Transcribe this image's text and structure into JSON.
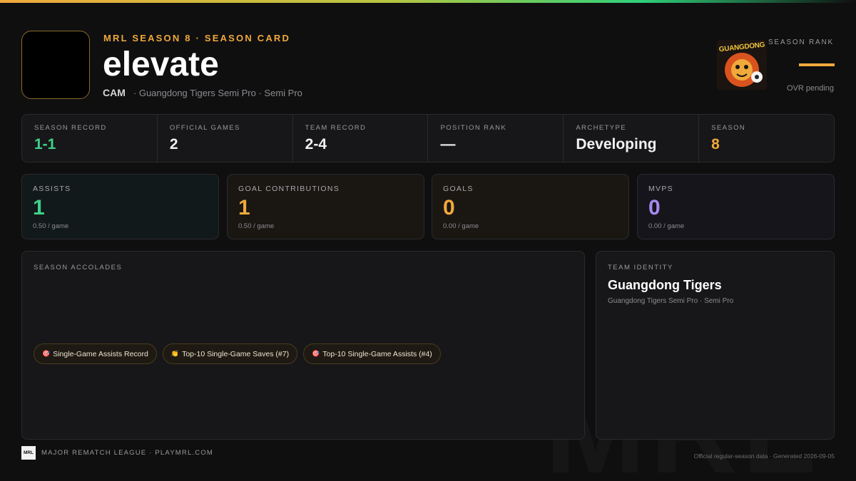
{
  "header": {
    "eyebrow": "MRL SEASON 8 · SEASON CARD",
    "player_name": "elevate",
    "position": "CAM",
    "team_line": "· Guangdong Tigers Semi Pro · Semi Pro",
    "rank_label": "SEASON RANK",
    "rank_sub": "OVR pending",
    "crest_text": "GUANGDONG"
  },
  "strip": [
    {
      "label": "SEASON RECORD",
      "value": "1-1"
    },
    {
      "label": "OFFICIAL GAMES",
      "value": "2"
    },
    {
      "label": "TEAM RECORD",
      "value": "2-4"
    },
    {
      "label": "POSITION RANK",
      "value": "—"
    },
    {
      "label": "ARCHETYPE",
      "value": "Developing"
    },
    {
      "label": "SEASON",
      "value": "8"
    }
  ],
  "cards": [
    {
      "label": "ASSISTS",
      "value": "1",
      "sub": "0.50 / game"
    },
    {
      "label": "GOAL CONTRIBUTIONS",
      "value": "1",
      "sub": "0.50 / game"
    },
    {
      "label": "GOALS",
      "value": "0",
      "sub": "0.00 / game"
    },
    {
      "label": "MVPS",
      "value": "0",
      "sub": "0.00 / game"
    }
  ],
  "accolades": {
    "label": "SEASON ACCOLADES",
    "items": [
      {
        "icon": "🎯",
        "text": "Single-Game Assists Record"
      },
      {
        "icon": "👏",
        "text": "Top-10 Single-Game Saves (#7)"
      },
      {
        "icon": "🎯",
        "text": "Top-10 Single-Game Assists (#4)"
      }
    ]
  },
  "team_identity": {
    "label": "TEAM IDENTITY",
    "name": "Guangdong Tigers",
    "sub": "Guangdong Tigers Semi Pro · Semi Pro"
  },
  "footer": {
    "logo": "MRL",
    "left": "MAJOR REMATCH LEAGUE · PLAYMRL.COM",
    "right": "Official regular-season data · Generated 2026-09-05"
  },
  "watermark": "MRL",
  "colors": {
    "accent_orange": "#f0a93b",
    "accent_green": "#3fd08a",
    "accent_purple": "#a58af0",
    "background": "#0f0f10"
  }
}
